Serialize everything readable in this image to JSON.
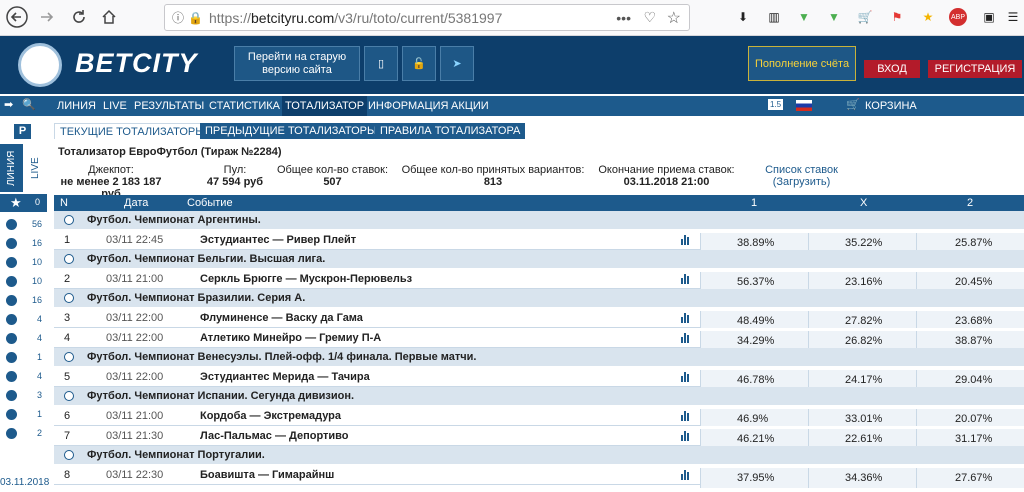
{
  "browser": {
    "url_prefix": "https://",
    "url_host": "betcityru.com",
    "url_path": "/v3/ru/toto/current/5381997"
  },
  "header": {
    "logo": "BETCITY",
    "old_site": "Перейти на старую версию сайта",
    "deposit": "Пополнение счёта",
    "login": "ВХОД",
    "register": "РЕГИСТРАЦИЯ"
  },
  "nav": {
    "items": [
      "ЛИНИЯ",
      "LIVE",
      "РЕЗУЛЬТАТЫ",
      "СТАТИСТИКА",
      "ТОТАЛИЗАТОР",
      "ИНФОРМАЦИЯ",
      "АКЦИИ"
    ],
    "badge": "1.5",
    "cart": "КОРЗИНА"
  },
  "sidebar": {
    "liniya": "ЛИНИЯ",
    "live": "LIVE",
    "counts": [
      "0",
      "56",
      "16",
      "10",
      "10",
      "16",
      "4",
      "4",
      "1",
      "4",
      "3",
      "1",
      "2"
    ],
    "date": "03.11.2018"
  },
  "subtabs": [
    "ТЕКУЩИЕ ТОТАЛИЗАТОРЫ",
    "ПРЕДЫДУЩИЕ ТОТАЛИЗАТОРЫ",
    "ПРАВИЛА ТОТАЛИЗАТОРА"
  ],
  "toto": {
    "title": "Тотализатор ЕвроФутбол (Тираж №2284)",
    "jackpot_label": "Джекпот:",
    "jackpot_value": "не менее 2 183 187 руб",
    "pool_label": "Пул:",
    "pool_value": "47 594 руб",
    "bets_label": "Общее кол-во ставок:",
    "bets_value": "507",
    "variants_label": "Общее кол-во принятых вариантов:",
    "variants_value": "813",
    "end_label": "Окончание приема ставок:",
    "end_value": "03.11.2018 21:00",
    "list_label": "Список ставок",
    "list_link": "(Загрузить)"
  },
  "table": {
    "headers": {
      "n": "N",
      "date": "Дата",
      "event": "Событие",
      "c1": "1",
      "cx": "X",
      "c2": "2"
    },
    "groups": [
      {
        "title": "Футбол. Чемпионат Аргентины.",
        "rows": [
          {
            "n": "1",
            "date": "03/11 22:45",
            "event": "Эстудиантес — Ривер Плейт",
            "p1": "38.89%",
            "px": "35.22%",
            "p2": "25.87%"
          }
        ]
      },
      {
        "title": "Футбол. Чемпионат Бельгии. Высшая лига.",
        "rows": [
          {
            "n": "2",
            "date": "03/11 21:00",
            "event": "Серкль Брюгге — Мускрон-Перювельз",
            "p1": "56.37%",
            "px": "23.16%",
            "p2": "20.45%"
          }
        ]
      },
      {
        "title": "Футбол. Чемпионат Бразилии. Серия А.",
        "rows": [
          {
            "n": "3",
            "date": "03/11 22:00",
            "event": "Флуминенсе — Васку да Гама",
            "p1": "48.49%",
            "px": "27.82%",
            "p2": "23.68%"
          },
          {
            "n": "4",
            "date": "03/11 22:00",
            "event": "Атлетико Минейро — Гремиу П-А",
            "p1": "34.29%",
            "px": "26.82%",
            "p2": "38.87%"
          }
        ]
      },
      {
        "title": "Футбол. Чемпионат Венесуэлы. Плей-офф. 1/4 финала. Первые матчи.",
        "rows": [
          {
            "n": "5",
            "date": "03/11 22:00",
            "event": "Эстудиантес Мерида — Тачира",
            "p1": "46.78%",
            "px": "24.17%",
            "p2": "29.04%"
          }
        ]
      },
      {
        "title": "Футбол. Чемпионат Испании. Сегунда дивизион.",
        "rows": [
          {
            "n": "6",
            "date": "03/11 21:00",
            "event": "Кордоба — Экстремадура",
            "p1": "46.9%",
            "px": "33.01%",
            "p2": "20.07%"
          },
          {
            "n": "7",
            "date": "03/11 21:30",
            "event": "Лас-Пальмас — Депортиво",
            "p1": "46.21%",
            "px": "22.61%",
            "p2": "31.17%"
          }
        ]
      },
      {
        "title": "Футбол. Чемпионат Португалии.",
        "rows": [
          {
            "n": "8",
            "date": "03/11 22:30",
            "event": "Боавишта — Гимарайнш",
            "p1": "37.95%",
            "px": "34.36%",
            "p2": "27.67%"
          }
        ]
      }
    ]
  }
}
